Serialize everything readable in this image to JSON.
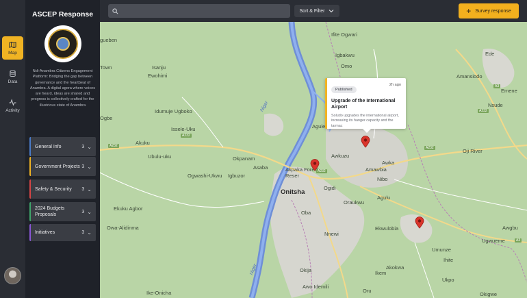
{
  "sidebar": {
    "title": "ASCEP Response",
    "seal_text": "NIGERIA",
    "description": "Ndi-Anambra Citizens Engagement Platform: Bridging the gap between governance and the heartbeat of Anambra. A digital agora where voices are heard, ideas are shared and progress is collectively crafted for the illustrious state of Anambra",
    "categories": [
      {
        "label": "General Info",
        "count": "3",
        "color": "#4a7bc8"
      },
      {
        "label": "Government Projects",
        "count": "3",
        "color": "#f0b323"
      },
      {
        "label": "Safety & Security",
        "count": "3",
        "color": "#d64545"
      },
      {
        "label": "2024 Budgets Proposals",
        "count": "3",
        "color": "#3fa66a"
      },
      {
        "label": "Initiatives",
        "count": "3",
        "color": "#8a56d6"
      }
    ]
  },
  "rail": {
    "items": [
      {
        "label": "Map",
        "icon": "map-icon",
        "active": true
      },
      {
        "label": "Data",
        "icon": "database-icon",
        "active": false
      },
      {
        "label": "Activity",
        "icon": "activity-icon",
        "active": false
      }
    ]
  },
  "topbar": {
    "search_placeholder": "",
    "sort_label": "Sort & Filter",
    "survey_label": "Survey response"
  },
  "popup": {
    "status": "Published",
    "time": "2h ago",
    "title": "Upgrade of the International Airport",
    "text": "Soludo upgrades the international airport, increasing its hanger capacity and the tarmac"
  },
  "map": {
    "places": [
      {
        "name": "gueben"
      },
      {
        "name": "Ifite Ogwari"
      },
      {
        "name": "Igbakwu"
      },
      {
        "name": "Omo"
      },
      {
        "name": "Town"
      },
      {
        "name": "Isanju"
      },
      {
        "name": "Ewohimi"
      },
      {
        "name": "Amansiodo"
      },
      {
        "name": "Ede"
      },
      {
        "name": "Nsude"
      },
      {
        "name": "Idumuje Ugboko"
      },
      {
        "name": "Ogbe"
      },
      {
        "name": "Issele-Uku"
      },
      {
        "name": "Aguleri"
      },
      {
        "name": "Akuku"
      },
      {
        "name": "Oji River"
      },
      {
        "name": "Ubulu-uku"
      },
      {
        "name": "Okpanam"
      },
      {
        "name": "Awkuzu"
      },
      {
        "name": "Awka"
      },
      {
        "name": "Asaba"
      },
      {
        "name": "Amawbia"
      },
      {
        "name": "Akpaka Forest Reser"
      },
      {
        "name": "Ogwashi-Ukwu"
      },
      {
        "name": "Igbuzor"
      },
      {
        "name": "Ogidi"
      },
      {
        "name": "Nibo"
      },
      {
        "name": "Onitsha"
      },
      {
        "name": "Ekuku Agbor"
      },
      {
        "name": "Oraukwu"
      },
      {
        "name": "Agulu"
      },
      {
        "name": "Oba"
      },
      {
        "name": "Owa-Alidinma"
      },
      {
        "name": "Ekwulobia"
      },
      {
        "name": "Awgbu"
      },
      {
        "name": "Nnewi"
      },
      {
        "name": "Ugwueme"
      },
      {
        "name": "Umunze"
      },
      {
        "name": "Ihite"
      },
      {
        "name": "Akokwa"
      },
      {
        "name": "Okija"
      },
      {
        "name": "Awo Idemili"
      },
      {
        "name": "Oru"
      },
      {
        "name": "Ike-Onicha"
      },
      {
        "name": "Okigwe"
      },
      {
        "name": "Ikem"
      },
      {
        "name": "Ukpo"
      },
      {
        "name": "Emene"
      }
    ],
    "rivers": [
      "Niger",
      "Niger"
    ],
    "shields": [
      "A232",
      "A232",
      "A232",
      "A232",
      "A232",
      "A3",
      "A3"
    ]
  }
}
